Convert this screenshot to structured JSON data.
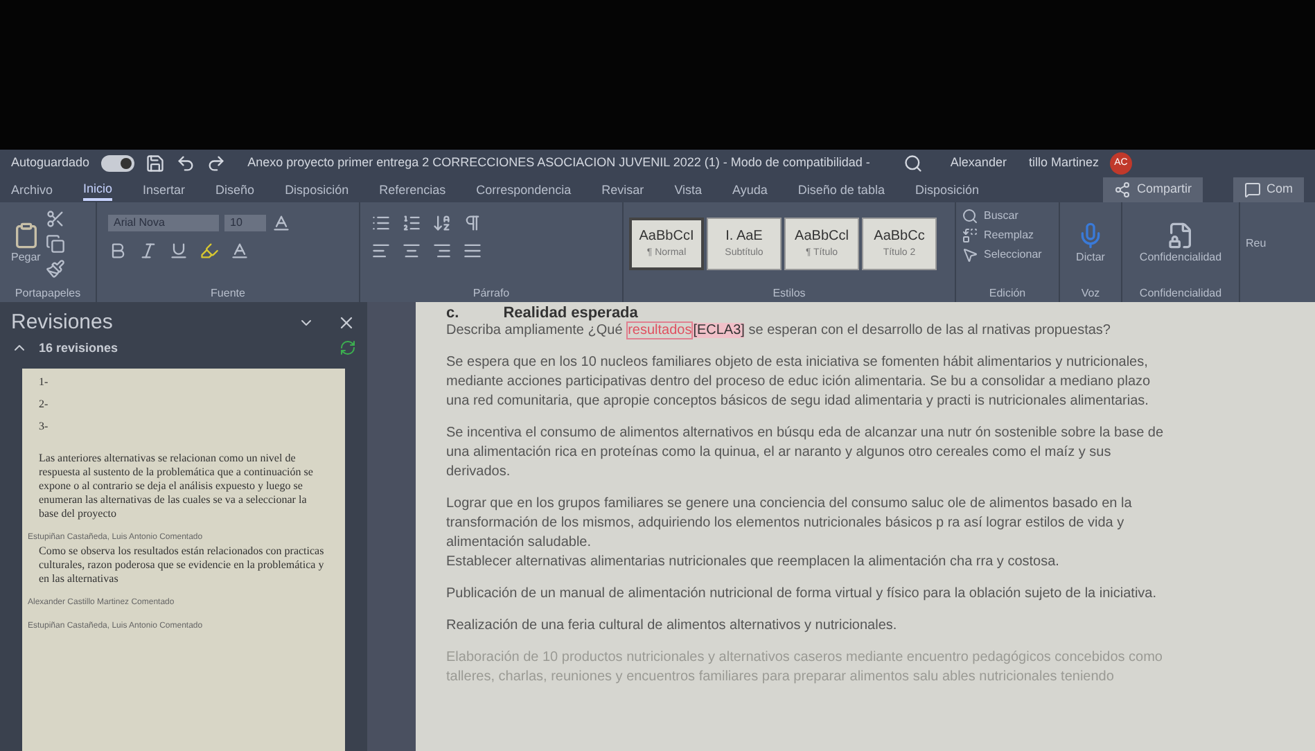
{
  "title_bar": {
    "autosave_label": "Autoguardado",
    "autosave_on": true,
    "document_title": "Anexo proyecto primer entrega 2 CORRECCIONES ASOCIACION JUVENIL 2022 (1) - Modo de compatibilidad -",
    "user_name": "Alexander",
    "user_name_rest": "tillo Martinez",
    "user_initials": "AC"
  },
  "ribbon": {
    "tabs": [
      {
        "label": "Archivo",
        "selected": false
      },
      {
        "label": "Inicio",
        "selected": true
      },
      {
        "label": "Insertar",
        "selected": false
      },
      {
        "label": "Diseño",
        "selected": false
      },
      {
        "label": "Disposición",
        "selected": false
      },
      {
        "label": "Referencias",
        "selected": false
      },
      {
        "label": "Correspondencia",
        "selected": false
      },
      {
        "label": "Revisar",
        "selected": false
      },
      {
        "label": "Vista",
        "selected": false
      },
      {
        "label": "Ayuda",
        "selected": false
      },
      {
        "label": "Diseño de tabla",
        "selected": false
      },
      {
        "label": "Disposición",
        "selected": false
      }
    ],
    "share_button": "Compartir",
    "comments_button": "Com",
    "clipboard": {
      "paste": "Pegar",
      "label": "Portapapeles"
    },
    "font": {
      "name": "Arial Nova",
      "size": "10",
      "label": "Fuente"
    },
    "paragraph": {
      "label": "Párrafo"
    },
    "styles": {
      "label": "Estilos",
      "items": [
        {
          "preview": "AaBbCcI",
          "name": "¶ Normal",
          "selected": true
        },
        {
          "preview": "I.  AaE",
          "name": "Subtítulo",
          "selected": false
        },
        {
          "preview": "AaBbCcl",
          "name": "¶ Título",
          "selected": false
        },
        {
          "preview": "AaBbCc",
          "name": "Título 2",
          "selected": false
        }
      ]
    },
    "editing": {
      "label": "Edición",
      "items": [
        "Buscar",
        "Reemplaz",
        "Seleccionar"
      ]
    },
    "voice": {
      "button": "Dictar",
      "label": "Voz"
    },
    "sensitivity": {
      "button": "Confidencialidad",
      "label": "Confidencialidad"
    },
    "cut_group": {
      "button": "Reu"
    }
  },
  "revisions_pane": {
    "title": "Revisiones",
    "count": "16 revisiones",
    "expanded": true,
    "list_items": [
      "1-",
      "2-",
      "3-"
    ],
    "paragraph": "Las anteriores alternativas se relacionan como un nivel de respuesta al sustento de la problemática que a continuación se expone o al contrario se deja el análisis expuesto y luego se enumeran las alternativas de las cuales se va a seleccionar la base del proyecto",
    "comments": [
      {
        "author": "Estupiñan Castañeda, Luis Antonio Comentado",
        "text": "Como se observa los resultados están relacionados con practicas culturales, razon poderosa que se evidencie en la problemática y en las alternativas"
      },
      {
        "author": "Alexander Castillo Martinez Comentado"
      },
      {
        "author": "Estupiñan Castañeda, Luis Antonio Comentado"
      }
    ]
  },
  "document": {
    "heading_number": "c.",
    "heading": "Realidad esperada",
    "question": {
      "before": "Describa ampliamente ¿Qué ",
      "marked": "resultados",
      "comment_ref": "[ECLA3]",
      "after": " se esperan con el desarrollo de las al  rnativas propuestas?"
    },
    "paragraphs": [
      {
        "kind": "normal",
        "lines": [
          "Se espera que en los 10 nucleos familiares objeto de esta iniciativa se fomenten hábit  alimentarios y nutricionales,",
          "mediante acciones participativas dentro del proceso de educ ición alimentaria. Se bu  a consolidar a mediano plazo",
          "una red comunitaria, que apropie conceptos básicos de segu idad alimentaria y practi  is nutricionales alimentarias."
        ]
      },
      {
        "kind": "normal",
        "lines": [
          "Se incentiva el consumo de alimentos alternativos en búsqu eda de alcanzar una nutr  ón sostenible sobre la base de",
          "una alimentación rica en proteínas como la quinua, el ar naranto y algunos otro  cereales como el maíz y sus",
          "derivados."
        ]
      },
      {
        "kind": "normal",
        "lines": [
          "Lograr que en los grupos familiares se genere una conciencia del consumo saluc  ole de alimentos basado en la",
          "transformación de los mismos, adquiriendo los elementos nutricionales básicos p  ra así lograr estilos de vida y",
          "alimentación saludable.",
          "Establecer alternativas alimentarias nutricionales que reemplacen la alimentación cha  rra y costosa."
        ]
      },
      {
        "kind": "normal",
        "lines": [
          "Publicación   de un manual de alimentación nutricional de forma virtual y físico para la  oblación sujeto de la iniciativa."
        ]
      },
      {
        "kind": "normal",
        "lines": [
          "Realización de una feria cultural de alimentos alternativos y nutricionales."
        ]
      },
      {
        "kind": "faded",
        "lines": [
          "Elaboración de 10 productos nutricionales y alternativos caseros mediante encuentro  pedagógicos concebidos como",
          "talleres, charlas, reuniones y encuentros familiares para preparar alimentos salu  ables nutricionales teniendo"
        ]
      }
    ]
  }
}
